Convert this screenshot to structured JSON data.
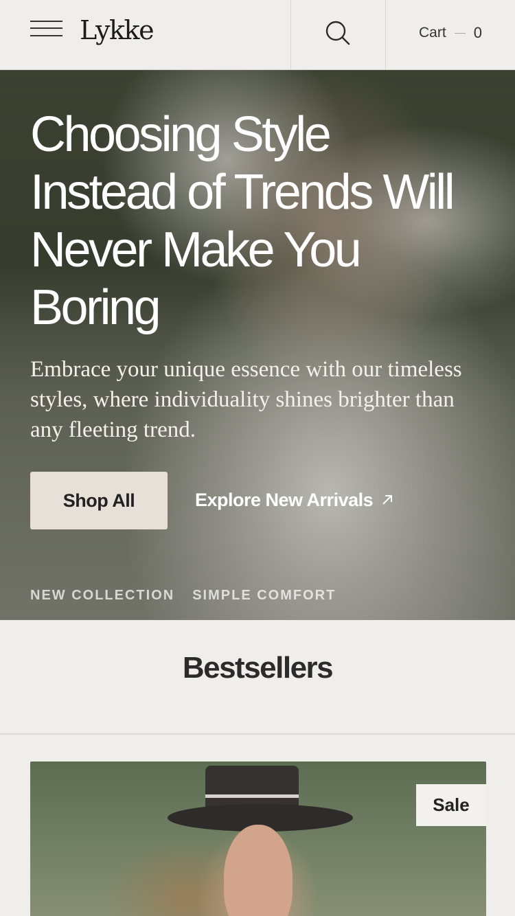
{
  "header": {
    "logo": "Lykke",
    "cart_label": "Cart",
    "cart_count": "0",
    "icons": {
      "menu": "hamburger-menu-icon",
      "search": "search-icon"
    }
  },
  "hero": {
    "title": "Choosing Style Instead of Trends Will Never Make You Boring",
    "subtitle": "Embrace your unique essence with our timeless styles, where individuality shines brighter than any fleeting trend.",
    "primary_button": "Shop All",
    "secondary_link": "Explore New Arrivals",
    "tags": [
      "NEW COLLECTION",
      "SIMPLE COMFORT"
    ]
  },
  "bestsellers": {
    "title": "Bestsellers",
    "products": [
      {
        "badge": "Sale"
      }
    ]
  },
  "colors": {
    "background": "#f0eeea",
    "primary_button_bg": "#e7e0d9",
    "text_dark": "#222222",
    "hero_text": "#ffffff"
  }
}
